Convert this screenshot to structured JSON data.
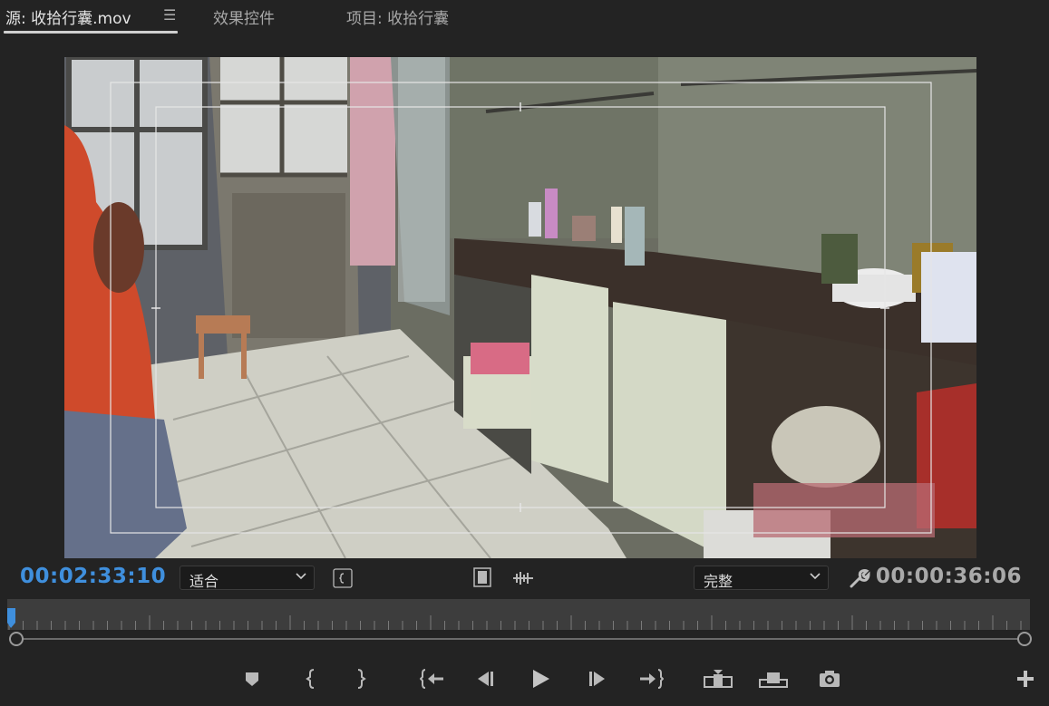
{
  "tabs": {
    "source": "源: 收拾行囊.mov",
    "menu_icon": "☰",
    "effects": "效果控件",
    "project": "项目: 收拾行囊"
  },
  "viewer": {
    "content": "video-frame-room-interior"
  },
  "controls": {
    "current_timecode": "00:02:33:10",
    "zoom_value": "适合",
    "quality_value": "完整",
    "duration_timecode": "00:00:36:06"
  },
  "icons": {
    "mark": "marker-icon",
    "in": "mark-in-icon",
    "out": "mark-out-icon",
    "goto_in": "go-to-in-icon",
    "step_back": "step-back-icon",
    "play": "play-icon",
    "step_forward": "step-forward-icon",
    "goto_out": "go-to-out-icon",
    "insert": "insert-icon",
    "overwrite": "overwrite-icon",
    "export_frame": "camera-icon",
    "add": "plus-icon"
  },
  "colors": {
    "accent": "#3f8fdd",
    "panel": "#232323",
    "ruler": "#3d3d3d"
  }
}
